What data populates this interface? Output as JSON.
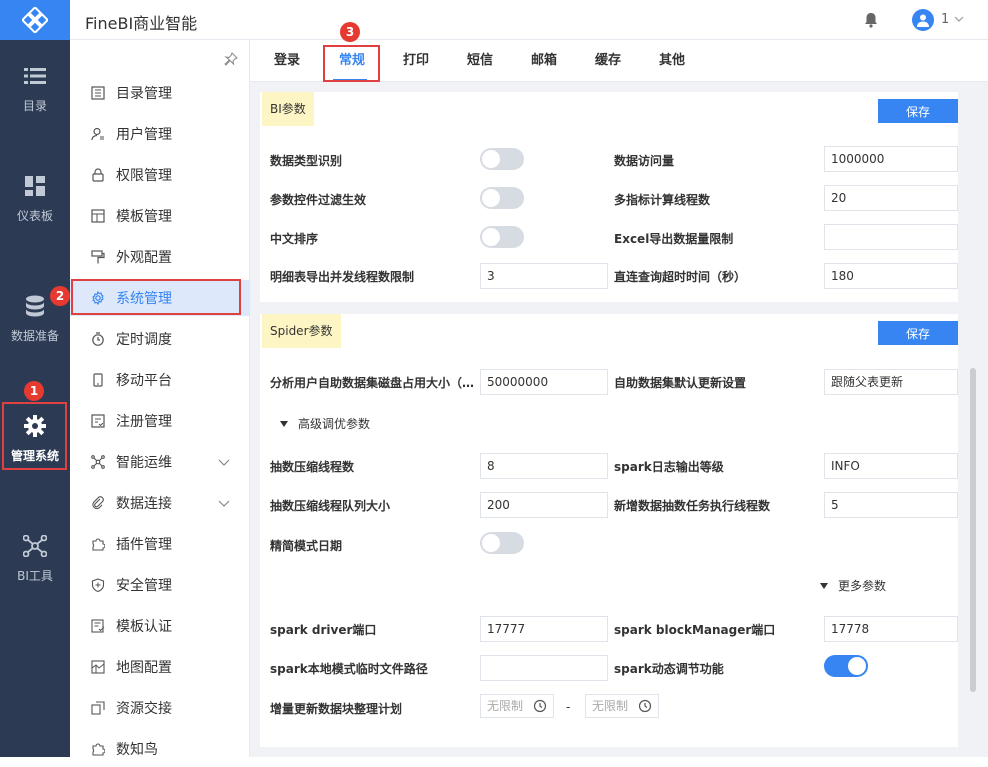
{
  "app": {
    "title": "FineBI商业智能",
    "user": "1"
  },
  "left_nav": [
    {
      "label": "目录",
      "icon": "list-icon"
    },
    {
      "label": "仪表板",
      "icon": "dashboard-icon"
    },
    {
      "label": "数据准备",
      "icon": "database-icon"
    },
    {
      "label": "管理系统",
      "icon": "gear-icon",
      "active": true
    },
    {
      "label": "BI工具",
      "icon": "tools-icon"
    }
  ],
  "sub_nav": [
    {
      "label": "目录管理"
    },
    {
      "label": "用户管理"
    },
    {
      "label": "权限管理"
    },
    {
      "label": "模板管理"
    },
    {
      "label": "外观配置"
    },
    {
      "label": "系统管理",
      "active": true
    },
    {
      "label": "定时调度"
    },
    {
      "label": "移动平台"
    },
    {
      "label": "注册管理"
    },
    {
      "label": "智能运维",
      "expandable": true
    },
    {
      "label": "数据连接",
      "expandable": true
    },
    {
      "label": "插件管理"
    },
    {
      "label": "安全管理"
    },
    {
      "label": "模板认证"
    },
    {
      "label": "地图配置"
    },
    {
      "label": "资源交接"
    },
    {
      "label": "数知鸟"
    }
  ],
  "tabs": [
    {
      "label": "登录"
    },
    {
      "label": "常规",
      "active": true
    },
    {
      "label": "打印"
    },
    {
      "label": "短信"
    },
    {
      "label": "邮箱"
    },
    {
      "label": "缓存"
    },
    {
      "label": "其他"
    }
  ],
  "bi_panel": {
    "title": "BI参数",
    "save": "保存",
    "rows": {
      "data_type_recognition": {
        "label": "数据类型识别",
        "on": false
      },
      "data_access_volume": {
        "label": "数据访问量",
        "value": "1000000"
      },
      "param_filter": {
        "label": "参数控件过滤生效",
        "on": false
      },
      "multi_index_threads": {
        "label": "多指标计算线程数",
        "value": "20"
      },
      "chinese_sort": {
        "label": "中文排序",
        "on": false
      },
      "excel_export_limit": {
        "label": "Excel导出数据量限制",
        "value": ""
      },
      "detail_export_threads": {
        "label": "明细表导出并发线程数限制",
        "value": "3"
      },
      "direct_query_timeout": {
        "label": "直连查询超时时间（秒）",
        "value": "180"
      }
    }
  },
  "spider_panel": {
    "title": "Spider参数",
    "save": "保存",
    "disk_usage": {
      "label": "分析用户自助数据集磁盘占用大小（…",
      "value": "50000000"
    },
    "default_update": {
      "label": "自助数据集默认更新设置",
      "value": "跟随父表更新"
    },
    "advanced": "高级调优参数",
    "extract_threads": {
      "label": "抽数压缩线程数",
      "value": "8"
    },
    "spark_log_level": {
      "label": "spark日志输出等级",
      "value": "INFO"
    },
    "extract_queue": {
      "label": "抽数压缩线程队列大小",
      "value": "200"
    },
    "new_extract_threads": {
      "label": "新增数据抽数任务执行线程数",
      "value": "5"
    },
    "simple_date": {
      "label": "精简模式日期",
      "on": false
    },
    "more": "更多参数",
    "spark_driver_port": {
      "label": "spark driver端口",
      "value": "17777"
    },
    "spark_block_port": {
      "label": "spark blockManager端口",
      "value": "17778"
    },
    "spark_local_path": {
      "label": "spark本地模式临时文件路径",
      "value": ""
    },
    "spark_dynamic": {
      "label": "spark动态调节功能",
      "on": true
    },
    "incremental_plan": {
      "label": "增量更新数据块整理计划",
      "from": "无限制",
      "sep": "-",
      "to": "无限制"
    }
  },
  "annotations": [
    "1",
    "2",
    "3"
  ],
  "colors": {
    "accent": "#3685f2",
    "nav_bg": "#2c3b53",
    "highlight": "#e04040",
    "title_bg": "#fdf5c3"
  }
}
